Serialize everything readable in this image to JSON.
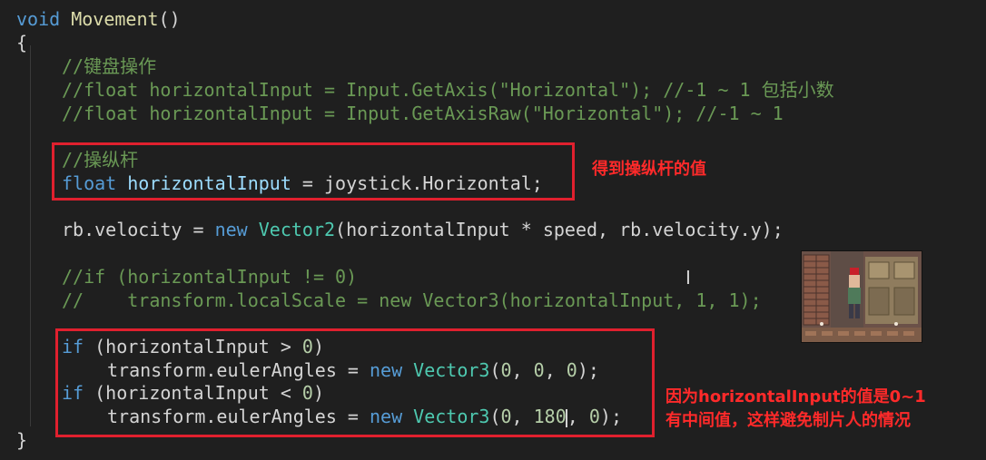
{
  "code": {
    "l1": {
      "kw": "void",
      "name": "Movement",
      "rest": "()"
    },
    "l2": "{",
    "l3": "//键盘操作",
    "l4": "//float horizontalInput = Input.GetAxis(\"Horizontal\"); //-1 ~ 1 包括小数",
    "l5": "//float horizontalInput = Input.GetAxisRaw(\"Horizontal\"); //-1 ~ 1",
    "l6": "//操纵杆",
    "l7": {
      "kw": "float",
      "var": "horizontalInput",
      "rest": " = joystick.Horizontal;"
    },
    "l8": {
      "a": "rb.velocity = ",
      "kw": "new",
      "ty": "Vector2",
      "b": "(horizontalInput * speed, rb.velocity.y);"
    },
    "l9": "//if (horizontalInput != 0)",
    "l10": "//    transform.localScale = new Vector3(horizontalInput, 1, 1);",
    "l11": {
      "kw": "if",
      "a": " (horizontalInput > ",
      "n": "0",
      "b": ")"
    },
    "l12": {
      "a": "transform.eulerAngles = ",
      "kw": "new",
      "ty": "Vector3",
      "b": "(",
      "n1": "0",
      ",": ", ",
      "n2": "0",
      "n3": "0",
      "c": ");"
    },
    "l13": {
      "kw": "if",
      "a": " (horizontalInput < ",
      "n": "0",
      "b": ")"
    },
    "l14": {
      "a": "transform.eulerAngles = ",
      "kw": "new",
      "ty": "Vector3",
      "b": "(",
      "n1": "0",
      "n2": "180",
      "n3": "0",
      "c": ");"
    },
    "l15": "}"
  },
  "annotations": {
    "joystick_note": "得到操纵杆的值",
    "rotation_note_1": "因为horizontalInput的值是0~1",
    "rotation_note_2": "有中间值，这样避免制片人的情况"
  },
  "cursor_icon": "i-beam-cursor-icon",
  "colors": {
    "background": "#1f1f1f",
    "keyword": "#569cd6",
    "function": "#dcdcaa",
    "type": "#4ec9b0",
    "comment": "#6a9955",
    "number": "#b5cea8",
    "annotation": "#ff2a2a"
  }
}
